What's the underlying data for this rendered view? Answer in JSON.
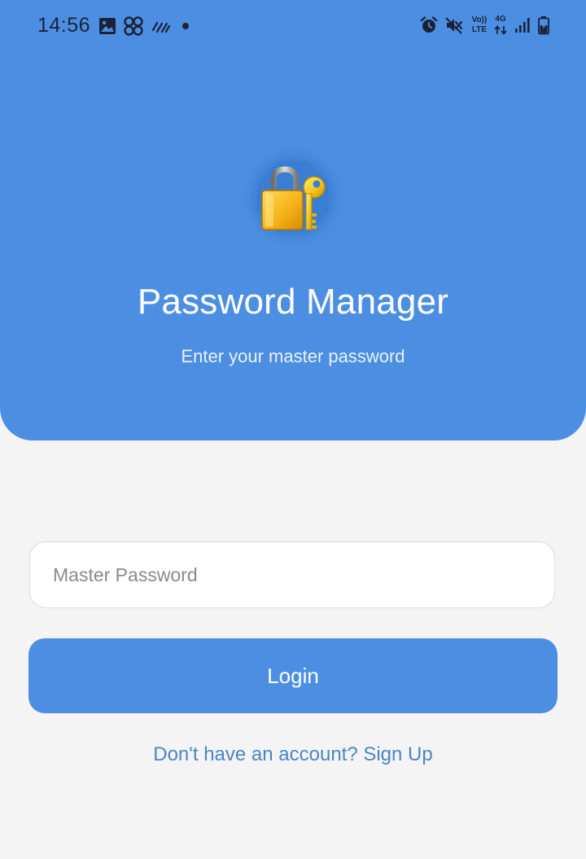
{
  "status_bar": {
    "time": "14:56",
    "volte_label_top": "Vo))",
    "volte_label_bottom": "LTE",
    "network_label": "4G",
    "left_icons": [
      "gallery-icon",
      "link-app-icon",
      "data-saver-icon",
      "notification-dot-icon"
    ],
    "right_icons": [
      "alarm-icon",
      "mute-icon",
      "volte-icon",
      "4g-data-icon",
      "signal-icon",
      "battery-charging-icon"
    ]
  },
  "header": {
    "title": "Password Manager",
    "subtitle": "Enter your master password",
    "logo_icon": "lock-and-key-icon",
    "background_color": "#4c8fe2"
  },
  "form": {
    "password_placeholder": "Master Password",
    "password_value": "",
    "login_label": "Login",
    "signup_text": "Don't have an account? Sign Up"
  },
  "colors": {
    "primary": "#4c8fe2",
    "background": "#f4f4f4",
    "link": "#4a86c8"
  }
}
